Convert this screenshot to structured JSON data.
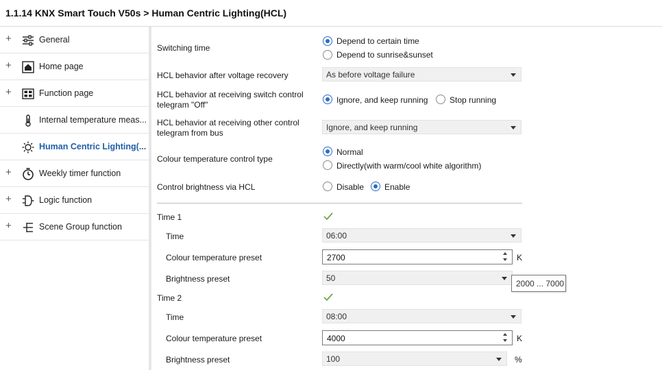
{
  "window": {
    "title": "1.1.14 KNX Smart Touch V50s > Human Centric Lighting(HCL)"
  },
  "sidebar": {
    "items": [
      {
        "label": "General",
        "expandable": "+",
        "icon": "sliders-icon"
      },
      {
        "label": "Home page",
        "expandable": "+",
        "icon": "home-icon"
      },
      {
        "label": "Function page",
        "expandable": "+",
        "icon": "grid-icon"
      },
      {
        "label": "Internal temperature meas...",
        "expandable": "",
        "icon": "thermometer-icon"
      },
      {
        "label": "Human Centric Lighting(...",
        "expandable": "",
        "icon": "sun-icon"
      },
      {
        "label": "Weekly timer function",
        "expandable": "+",
        "icon": "clock-icon"
      },
      {
        "label": "Logic function",
        "expandable": "+",
        "icon": "logic-gate-icon"
      },
      {
        "label": "Scene Group function",
        "expandable": "+",
        "icon": "scene-tree-icon"
      }
    ],
    "active_index": 4
  },
  "form": {
    "switching_time": {
      "label": "Switching time",
      "options": [
        "Depend to certain time",
        "Depend to sunrise&sunset"
      ],
      "selected": 0
    },
    "recovery": {
      "label": "HCL behavior after voltage recovery",
      "value": "As before voltage failure"
    },
    "switch_off": {
      "label_line1": "HCL behavior at receiving switch control",
      "label_line2": "telegram \"Off\"",
      "options": [
        "Ignore, and keep running",
        "Stop running"
      ],
      "selected": 0
    },
    "other_control": {
      "label_line1": "HCL behavior at receiving other control",
      "label_line2": "telegram from bus",
      "value": "Ignore, and keep running"
    },
    "colour_type": {
      "label": "Colour temperature control type",
      "options": [
        "Normal",
        "Directly(with warm/cool white algorithm)"
      ],
      "selected": 0
    },
    "brightness_hcl": {
      "label": "Control brightness via HCL",
      "options": [
        "Disable",
        "Enable"
      ],
      "selected": 1
    },
    "time1": {
      "label": "Time 1",
      "checked": true,
      "time_label": "Time",
      "time_value": "06:00",
      "ct_label": "Colour temperature preset",
      "ct_value": "2700",
      "ct_unit": "K",
      "br_label": "Brightness preset",
      "br_value": "50"
    },
    "time2": {
      "label": "Time 2",
      "checked": true,
      "time_label": "Time",
      "time_value": "08:00",
      "ct_label": "Colour temperature preset",
      "ct_value": "4000",
      "ct_unit": "K",
      "br_label": "Brightness preset",
      "br_value": "100",
      "br_unit": "%"
    },
    "tooltip": "2000 ... 7000"
  },
  "colors": {
    "accent": "#2b6cc4",
    "active_nav": "#1f5fa8",
    "check": "#6aa84f"
  }
}
